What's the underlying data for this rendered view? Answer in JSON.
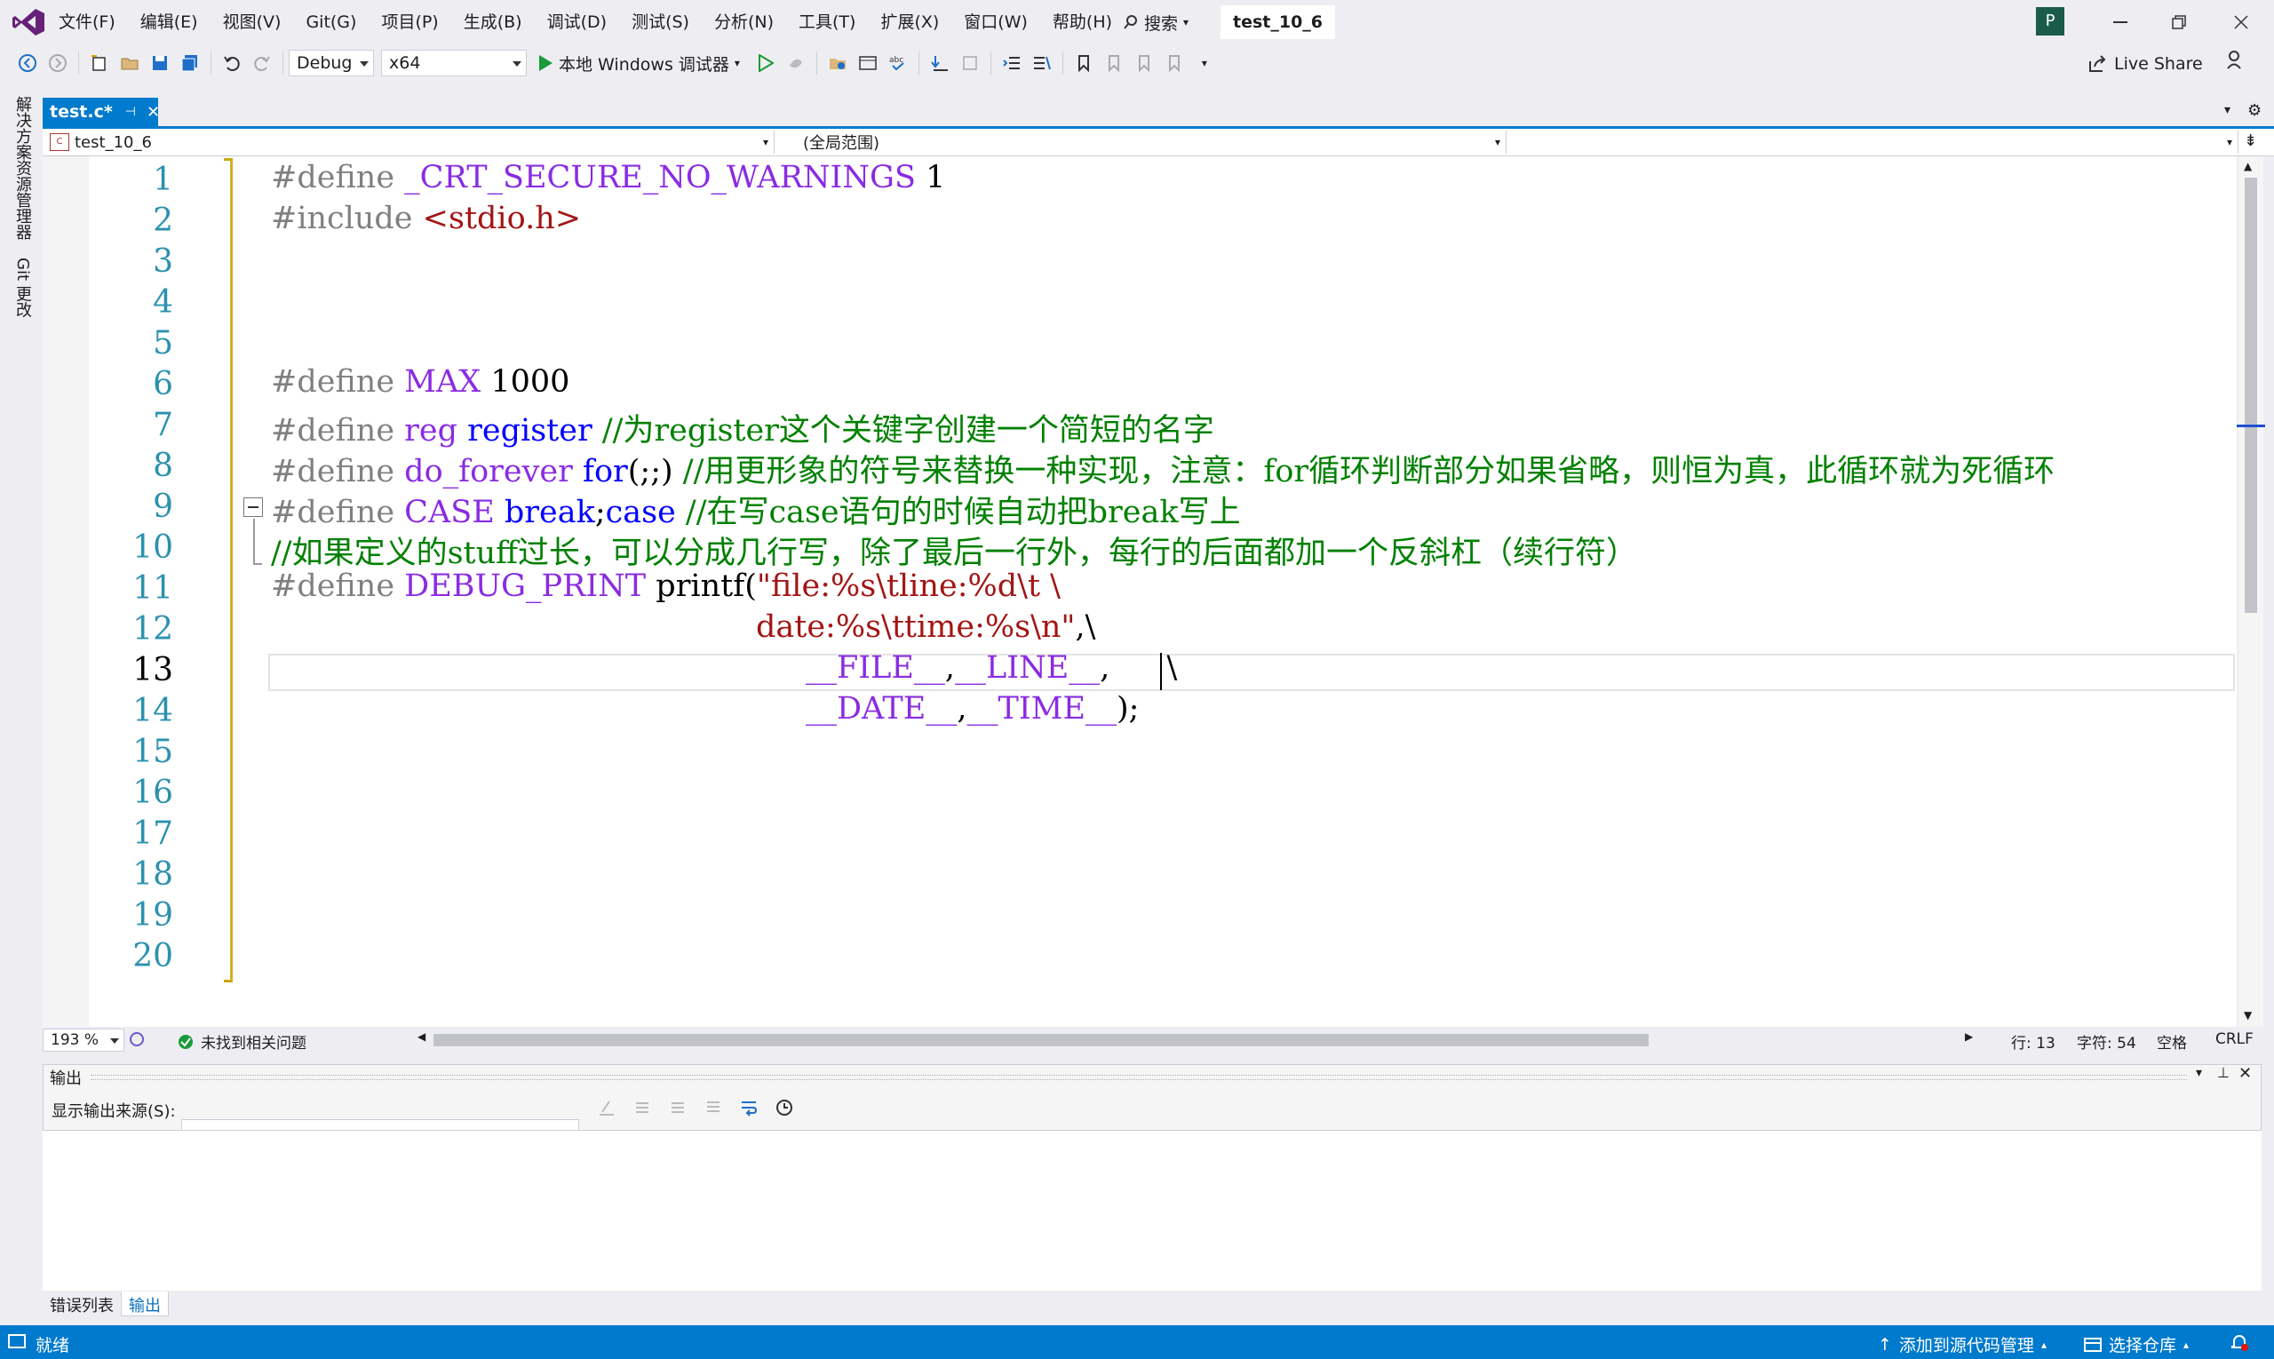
{
  "menu": {
    "items": [
      "文件(F)",
      "编辑(E)",
      "视图(V)",
      "Git(G)",
      "项目(P)",
      "生成(B)",
      "调试(D)",
      "测试(S)",
      "分析(N)",
      "工具(T)",
      "扩展(X)",
      "窗口(W)",
      "帮助(H)"
    ],
    "search_label": "搜索",
    "solution_name": "test_10_6",
    "account_initial": "P"
  },
  "toolbar": {
    "configuration": "Debug",
    "platform": "x64",
    "start_debug_label": "本地 Windows 调试器",
    "live_share_label": "Live Share"
  },
  "sidebar": {
    "solution_explorer": "解决方案资源管理器",
    "git_changes": "Git 更改"
  },
  "document_tab": {
    "label": "test.c*"
  },
  "navbar": {
    "project": "test_10_6",
    "scope": "(全局范围)",
    "member": ""
  },
  "editor": {
    "line_numbers": [
      "1",
      "2",
      "3",
      "4",
      "5",
      "6",
      "7",
      "8",
      "9",
      "10",
      "11",
      "12",
      "13",
      "14",
      "15",
      "16",
      "17",
      "18",
      "19",
      "20"
    ],
    "current_line": "13",
    "code": {
      "l1": {
        "a": "#define ",
        "b": "_CRT_SECURE_NO_WARNINGS",
        "c": " 1"
      },
      "l2": {
        "a": "#include ",
        "b": "<stdio.h>"
      },
      "l6": {
        "a": "#define ",
        "b": "MAX",
        "c": " 1000"
      },
      "l7": {
        "a": "#define ",
        "b": "reg",
        "c": " ",
        "d": "register",
        "e": " //为register这个关键字创建一个简短的名字"
      },
      "l8": {
        "a": "#define ",
        "b": "do_forever",
        "c": " ",
        "d": "for",
        "e": "(;;) ",
        "f": "//用更形象的符号来替换一种实现，注意：for循环判断部分如果省略，则恒为真，此循环就为死循环"
      },
      "l9": {
        "a": "#define ",
        "b": "CASE",
        "c": " ",
        "d": "break",
        "e": ";",
        "f": "case",
        "g": " //在写case语句的时候自动把break写上"
      },
      "l10": {
        "a": "//如果定义的stuff过长，可以分成几行写，除了最后一行外，每行的后面都加一个反斜杠（续行符）"
      },
      "l11": {
        "a": "#define ",
        "b": "DEBUG_PRINT",
        "c": " printf(",
        "d": "\"file:%s\\tline:%d\\t \\"
      },
      "l12": {
        "a": "date:%s\\ttime:%s\\n\"",
        "b": ",\\"
      },
      "l13": {
        "a": "__FILE__",
        "b": ",",
        "c": "__LINE__",
        "d": ",",
        "e": "\\"
      },
      "l14": {
        "a": "__DATE__",
        "b": ",",
        "c": "__TIME__",
        "d": ");"
      }
    }
  },
  "edit_status": {
    "zoom": "193 %",
    "issues": "未找到相关问题",
    "line": "行: 13",
    "char": "字符: 54",
    "whitespace": "空格",
    "line_ending": "CRLF"
  },
  "output": {
    "title": "输出",
    "source_label": "显示输出来源(S):",
    "source_value": ""
  },
  "bottom_tabs": [
    "错误列表",
    "输出"
  ],
  "status_bar": {
    "ready": "就绪",
    "add_source_control": "添加到源代码管理",
    "select_repo": "选择仓库"
  },
  "colors": {
    "accent": "#007acc",
    "comment": "#008000",
    "macro": "#8a2be2",
    "string": "#a31515",
    "keyword": "#0000ff",
    "preprocessor": "#808080",
    "change_bar": "#d4af20"
  }
}
